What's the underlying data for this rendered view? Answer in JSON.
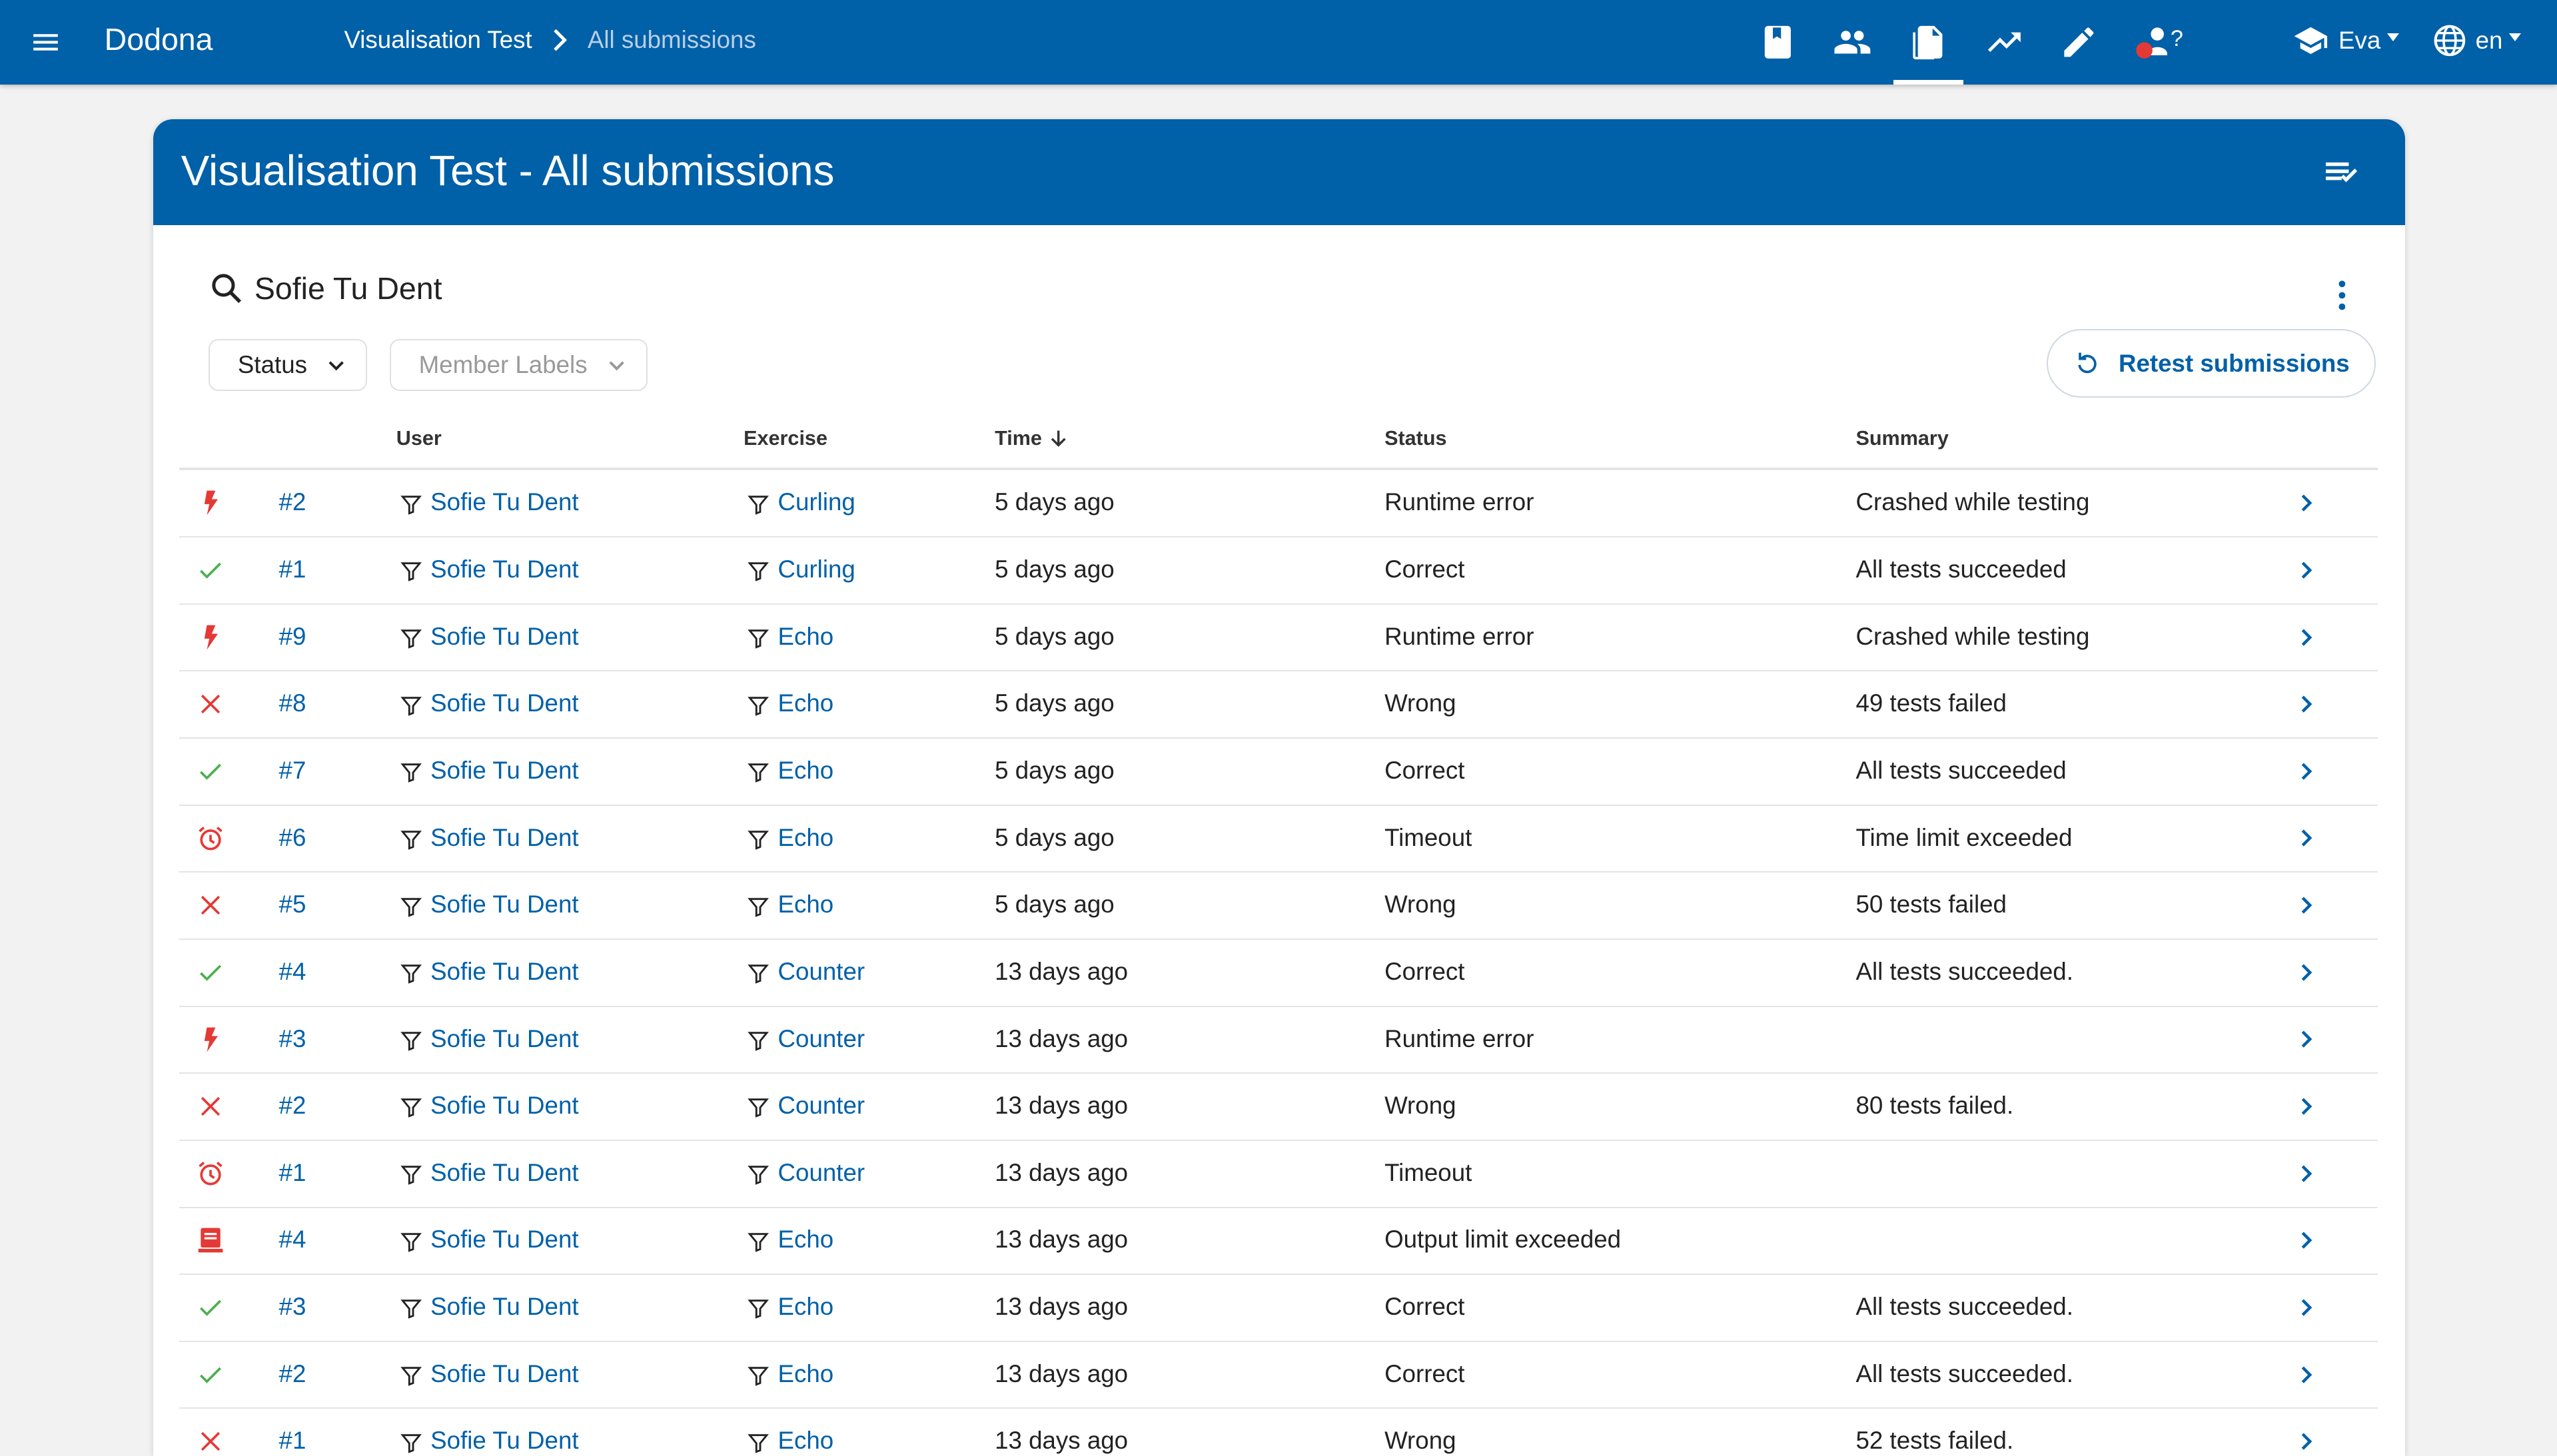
{
  "app": {
    "name": "Dodona"
  },
  "breadcrumb": {
    "course": "Visualisation Test",
    "current": "All submissions"
  },
  "topnav": {
    "icons": [
      "book-icon",
      "people-icon",
      "submissions-icon",
      "stats-icon",
      "edit-icon",
      "user-question-icon"
    ],
    "user_question_mark": "?",
    "user": "Eva",
    "lang": "en"
  },
  "card": {
    "title": "Visualisation Test - All submissions"
  },
  "search": {
    "value": "Sofie Tu Dent",
    "placeholder": ""
  },
  "filters": {
    "status_label": "Status",
    "member_labels_label": "Member Labels"
  },
  "actions": {
    "retest_label": "Retest submissions"
  },
  "table": {
    "headers": {
      "user": "User",
      "exercise": "Exercise",
      "time": "Time",
      "status": "Status",
      "summary": "Summary"
    },
    "rows": [
      {
        "icon": "runtime-error",
        "num": "#2",
        "user": "Sofie Tu Dent",
        "exercise": "Curling",
        "time": "5 days ago",
        "status": "Runtime error",
        "summary": "Crashed while testing"
      },
      {
        "icon": "correct",
        "num": "#1",
        "user": "Sofie Tu Dent",
        "exercise": "Curling",
        "time": "5 days ago",
        "status": "Correct",
        "summary": "All tests succeeded"
      },
      {
        "icon": "runtime-error",
        "num": "#9",
        "user": "Sofie Tu Dent",
        "exercise": "Echo",
        "time": "5 days ago",
        "status": "Runtime error",
        "summary": "Crashed while testing"
      },
      {
        "icon": "wrong",
        "num": "#8",
        "user": "Sofie Tu Dent",
        "exercise": "Echo",
        "time": "5 days ago",
        "status": "Wrong",
        "summary": "49 tests failed"
      },
      {
        "icon": "correct",
        "num": "#7",
        "user": "Sofie Tu Dent",
        "exercise": "Echo",
        "time": "5 days ago",
        "status": "Correct",
        "summary": "All tests succeeded"
      },
      {
        "icon": "timeout",
        "num": "#6",
        "user": "Sofie Tu Dent",
        "exercise": "Echo",
        "time": "5 days ago",
        "status": "Timeout",
        "summary": "Time limit exceeded"
      },
      {
        "icon": "wrong",
        "num": "#5",
        "user": "Sofie Tu Dent",
        "exercise": "Echo",
        "time": "5 days ago",
        "status": "Wrong",
        "summary": "50 tests failed"
      },
      {
        "icon": "correct",
        "num": "#4",
        "user": "Sofie Tu Dent",
        "exercise": "Counter",
        "time": "13 days ago",
        "status": "Correct",
        "summary": "All tests succeeded."
      },
      {
        "icon": "runtime-error",
        "num": "#3",
        "user": "Sofie Tu Dent",
        "exercise": "Counter",
        "time": "13 days ago",
        "status": "Runtime error",
        "summary": ""
      },
      {
        "icon": "wrong",
        "num": "#2",
        "user": "Sofie Tu Dent",
        "exercise": "Counter",
        "time": "13 days ago",
        "status": "Wrong",
        "summary": "80 tests failed."
      },
      {
        "icon": "timeout",
        "num": "#1",
        "user": "Sofie Tu Dent",
        "exercise": "Counter",
        "time": "13 days ago",
        "status": "Timeout",
        "summary": ""
      },
      {
        "icon": "output-limit",
        "num": "#4",
        "user": "Sofie Tu Dent",
        "exercise": "Echo",
        "time": "13 days ago",
        "status": "Output limit exceeded",
        "summary": ""
      },
      {
        "icon": "correct",
        "num": "#3",
        "user": "Sofie Tu Dent",
        "exercise": "Echo",
        "time": "13 days ago",
        "status": "Correct",
        "summary": "All tests succeeded."
      },
      {
        "icon": "correct",
        "num": "#2",
        "user": "Sofie Tu Dent",
        "exercise": "Echo",
        "time": "13 days ago",
        "status": "Correct",
        "summary": "All tests succeeded."
      },
      {
        "icon": "wrong",
        "num": "#1",
        "user": "Sofie Tu Dent",
        "exercise": "Echo",
        "time": "13 days ago",
        "status": "Wrong",
        "summary": "52 tests failed."
      }
    ]
  },
  "colors": {
    "primary": "#0060a8",
    "correct": "#4caf50",
    "error": "#e53935"
  }
}
